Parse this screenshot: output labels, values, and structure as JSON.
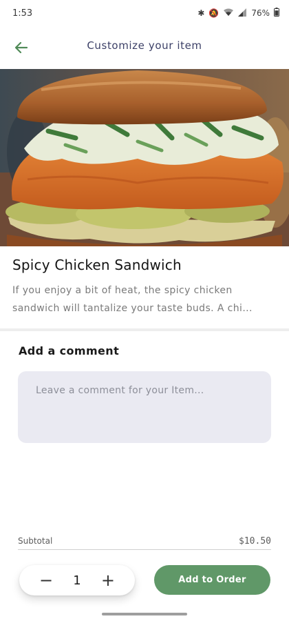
{
  "status_bar": {
    "time": "1:53",
    "battery": "76%",
    "icons": [
      "bluetooth-icon",
      "mute-icon",
      "wifi-icon",
      "signal-icon",
      "battery-icon"
    ]
  },
  "app_bar": {
    "title": "Customize your item",
    "back_icon": "arrow-left-icon"
  },
  "item": {
    "name": "Spicy Chicken Sandwich",
    "description": "If you enjoy a bit of heat, the spicy chicken sandwich will tantalize your taste buds. A chi..."
  },
  "comment": {
    "label": "Add a comment",
    "placeholder": "Leave a comment for your Item...",
    "value": ""
  },
  "order": {
    "subtotal_label": "Subtotal",
    "subtotal_value": "$10.50",
    "quantity": "1",
    "minus_label": "−",
    "plus_label": "+",
    "add_button_label": "Add to Order"
  },
  "colors": {
    "accent": "#609868",
    "title_text": "#3b3f66",
    "comment_bg": "#eaeaf2"
  }
}
